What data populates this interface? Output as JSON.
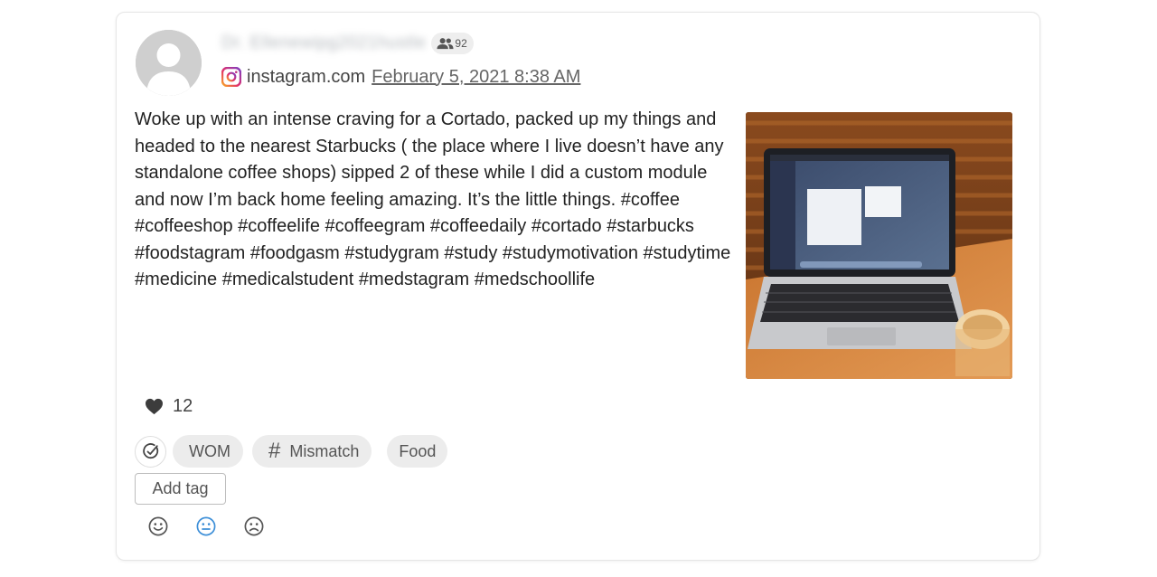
{
  "post": {
    "author_name": "Dr. Ellenewipg2021hustle",
    "followers_count": "92",
    "source": "instagram.com",
    "date": "February 5, 2021 8:38 AM",
    "text": "Woke up with an intense craving for a Cortado, packed up my things and headed to the nearest Starbucks ( the place where I live doesn’t have any standalone coffee shops) sipped 2 of these while I did a custom module and now I’m back home feeling amazing. It’s the little things. #coffee #coffeeshop #coffeelife #coffeegram #coffeedaily #cortado #starbucks #foodstagram #foodgasm #studygram #study #studymotivation #studytime #medicine #medicalstudent #medstagram #medschoollife",
    "likes": "12"
  },
  "tags": {
    "items": [
      "WOM",
      "Mismatch",
      "Food"
    ],
    "add_label": "Add tag"
  },
  "icons": {
    "avatar": "user-avatar-placeholder",
    "followers": "people-icon",
    "source": "instagram-icon",
    "like": "heart-icon",
    "tag_check": "check-circle-icon",
    "hash": "hash-icon",
    "sentiments": [
      "smile-icon",
      "neutral-face-icon",
      "frown-icon"
    ]
  },
  "colors": {
    "accent": "#3d8fd8",
    "tag_bg": "#ececec",
    "muted": "#666666"
  }
}
